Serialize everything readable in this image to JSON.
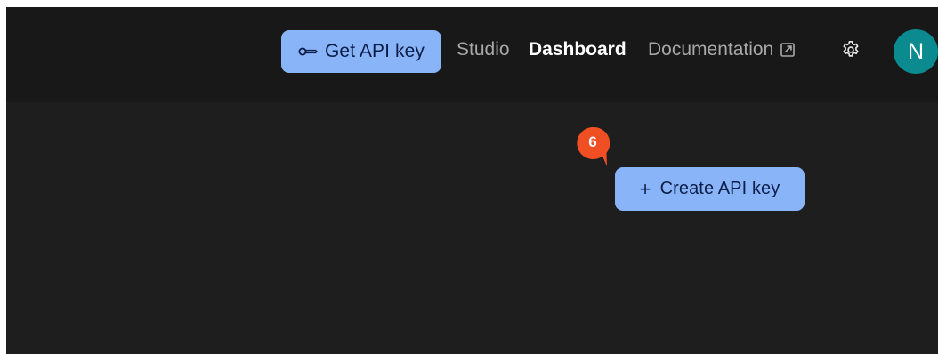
{
  "header": {
    "get_api_key_label": "Get API key",
    "nav": {
      "studio": "Studio",
      "dashboard": "Dashboard",
      "documentation": "Documentation"
    },
    "settings_icon": "gear-icon",
    "avatar_initial": "N"
  },
  "main": {
    "step_marker": "6",
    "create_api_key_plus": "+",
    "create_api_key_label": "Create API key"
  },
  "colors": {
    "frame_bg": "#1e1e1e",
    "topbar_bg": "#181818",
    "button_bg": "#8ab4f8",
    "button_text": "#0b1e47",
    "nav_active": "#ffffff",
    "nav_inactive": "#a8a8a8",
    "avatar_bg": "#0b8a8f",
    "marker_bg": "#f04e23"
  }
}
